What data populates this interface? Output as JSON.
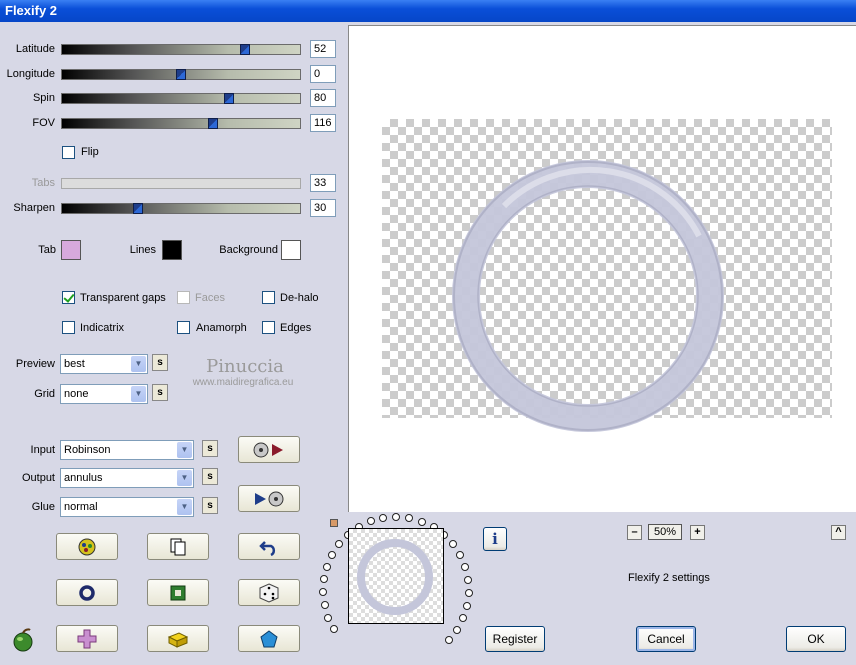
{
  "window": {
    "title": "Flexify 2"
  },
  "sliders": [
    {
      "label": "Latitude",
      "value": "52",
      "fraction": 0.78,
      "enabled": true
    },
    {
      "label": "Longitude",
      "value": "0",
      "fraction": 0.5,
      "enabled": true
    },
    {
      "label": "Spin",
      "value": "80",
      "fraction": 0.71,
      "enabled": true
    },
    {
      "label": "FOV",
      "value": "116",
      "fraction": 0.64,
      "enabled": true
    },
    {
      "label": "Tabs",
      "value": "33",
      "fraction": 0,
      "enabled": false
    },
    {
      "label": "Sharpen",
      "value": "30",
      "fraction": 0.31,
      "enabled": true
    }
  ],
  "flip": {
    "label": "Flip",
    "checked": false
  },
  "colors": {
    "tab": {
      "label": "Tab",
      "color": "#d7a9dc"
    },
    "lines": {
      "label": "Lines",
      "color": "#000000"
    },
    "background": {
      "label": "Background",
      "color": "#ffffff"
    }
  },
  "options": {
    "transparent_gaps": {
      "label": "Transparent gaps",
      "checked": true
    },
    "faces": {
      "label": "Faces",
      "checked": false
    },
    "de_halo": {
      "label": "De-halo",
      "checked": false
    },
    "indicatrix": {
      "label": "Indicatrix",
      "checked": false
    },
    "anamorph": {
      "label": "Anamorph",
      "checked": false
    },
    "edges": {
      "label": "Edges",
      "checked": false
    }
  },
  "preview_select": {
    "label": "Preview",
    "value": "best"
  },
  "grid_select": {
    "label": "Grid",
    "value": "none"
  },
  "watermark": {
    "name": "Pinuccia",
    "url": "www.maidiregrafica.eu"
  },
  "input_select": {
    "label": "Input",
    "value": "Robinson"
  },
  "output_select": {
    "label": "Output",
    "value": "annulus"
  },
  "glue_select": {
    "label": "Glue",
    "value": "normal"
  },
  "s_label": "s",
  "zoom": {
    "value": "50%",
    "minus": "–",
    "plus": "+"
  },
  "up_label": "^",
  "status_text": "Flexify 2 settings",
  "info_label": "i",
  "buttons": {
    "register": "Register",
    "cancel": "Cancel",
    "ok": "OK"
  },
  "accent_colors": {
    "title_bar": "#0a4fd8",
    "ring": "#c4c6da"
  }
}
